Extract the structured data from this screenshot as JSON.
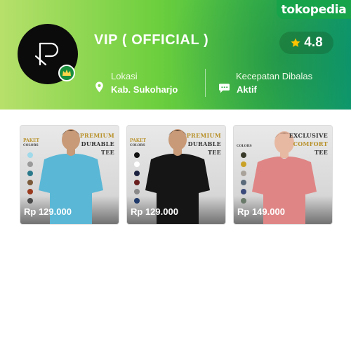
{
  "brand": {
    "name": "tokopedia",
    "color": "#16a34a"
  },
  "shop": {
    "name": "VIP ( OFFICIAL )",
    "rating": "4.8",
    "location_label": "Lokasi",
    "location_value": "Kab. Sukoharjo",
    "speed_label": "Kecepatan Dibalas",
    "speed_value": "Aktif",
    "icons": [
      "location-pin-icon",
      "chat-icon",
      "star-icon",
      "crown-badge-icon"
    ]
  },
  "products": [
    {
      "price": "Rp 129.000",
      "tshirt_color": "#5ab7d6",
      "promo": [
        "PREMIUM",
        "DURABLE",
        "TEE"
      ],
      "side_label": "PAKET",
      "side_sub": "COLORS",
      "swatches": [
        "#9fd9ea",
        "#9a9a9a",
        "#2b7a8c",
        "#7a5a3a",
        "#9a3a1e",
        "#4a4a4a"
      ]
    },
    {
      "price": "Rp 129.000",
      "tshirt_color": "#151515",
      "promo": [
        "PREMIUM",
        "DURABLE",
        "TEE"
      ],
      "side_label": "PAKET",
      "side_sub": "COLORS",
      "swatches": [
        "#111111",
        "#ffffff",
        "#1c2340",
        "#6a1e1e",
        "#8a8a8a",
        "#1f3a6a"
      ]
    },
    {
      "price": "Rp 149.000",
      "tshirt_color": "#e08585",
      "promo": [
        "EXCLUSIVE",
        "COMFORT",
        "TEE"
      ],
      "side_label": "",
      "side_sub": "COLORS",
      "swatches": [
        "#3a3a2a",
        "#c9a227",
        "#a8a29a",
        "#5a6a7a",
        "#3a4a7a",
        "#6a7a6a"
      ]
    }
  ]
}
